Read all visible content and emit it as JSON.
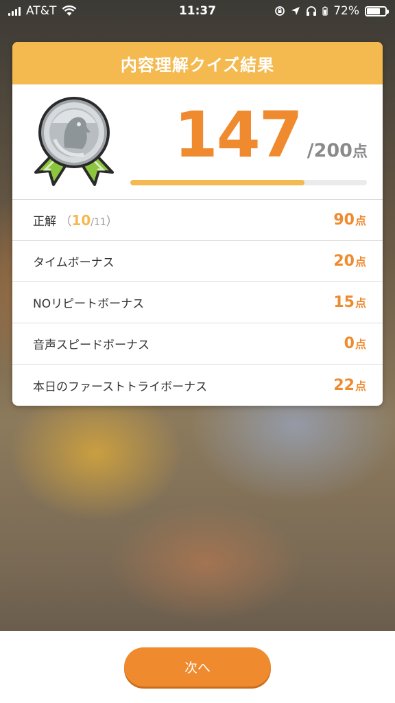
{
  "status_bar": {
    "carrier": "AT&T",
    "time": "11:37",
    "battery": "72%",
    "battery_level": 0.72
  },
  "card": {
    "title": "内容理解クイズ結果",
    "score": "147",
    "score_total": "/200",
    "score_unit": "点",
    "progress_fraction": 0.735,
    "medal_icon": "silver-medal-icon",
    "rows": [
      {
        "label": "正解",
        "paren_open": "（",
        "correct": "10",
        "total": "/11",
        "paren_close": "）",
        "points": "90",
        "unit": "点"
      },
      {
        "label": "タイムボーナス",
        "points": "20",
        "unit": "点"
      },
      {
        "label": "NOリピートボーナス",
        "points": "15",
        "unit": "点"
      },
      {
        "label": "音声スピードボーナス",
        "points": "0",
        "unit": "点"
      },
      {
        "label": "本日のファーストトライボーナス",
        "points": "22",
        "unit": "点"
      }
    ]
  },
  "footer": {
    "next_label": "次へ"
  },
  "colors": {
    "accent_orange": "#ef8a2e",
    "header_yellow": "#f4b94f",
    "medal_ribbon_green": "#8cc63f"
  }
}
